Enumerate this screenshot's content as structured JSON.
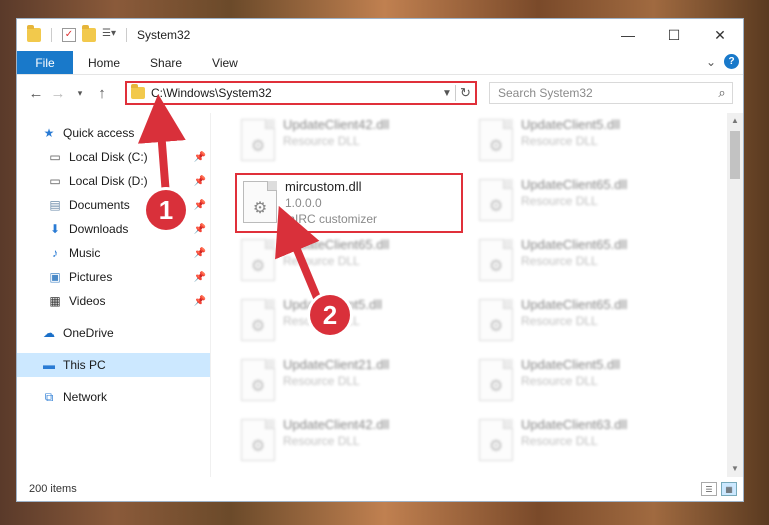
{
  "titlebar": {
    "title": "System32",
    "minimize": "—",
    "maximize": "☐",
    "close": "✕"
  },
  "ribbon": {
    "file": "File",
    "tabs": [
      "Home",
      "Share",
      "View"
    ],
    "expand": "⌄",
    "help": "?"
  },
  "address": {
    "path": "C:\\Windows\\System32",
    "search_placeholder": "Search System32"
  },
  "sidebar": {
    "quick_access": "Quick access",
    "items": [
      {
        "label": "Local Disk (C:)",
        "icon": "drive-icon"
      },
      {
        "label": "Local Disk (D:)",
        "icon": "drive-icon"
      },
      {
        "label": "Documents",
        "icon": "documents-icon"
      },
      {
        "label": "Downloads",
        "icon": "downloads-icon"
      },
      {
        "label": "Music",
        "icon": "music-icon"
      },
      {
        "label": "Pictures",
        "icon": "pictures-icon"
      },
      {
        "label": "Videos",
        "icon": "videos-icon"
      }
    ],
    "onedrive": "OneDrive",
    "this_pc": "This PC",
    "network": "Network"
  },
  "files": {
    "highlighted": {
      "name": "mircustom.dll",
      "version": "1.0.0.0",
      "description": "mIRC customizer"
    },
    "left_column": [
      {
        "name": "UpdateClient42.dll",
        "type": "Resource DLL"
      },
      {
        "name": "UpdateClient65.dll",
        "type": "Resource DLL"
      },
      {
        "name": "UpdateClient5.dll",
        "type": "Resource DLL"
      },
      {
        "name": "UpdateClient21.dll",
        "type": "Resource DLL"
      },
      {
        "name": "UpdateClient42.dll",
        "type": "Resource DLL"
      }
    ],
    "right_column": [
      {
        "name": "UpdateClient5.dll",
        "type": "Resource DLL"
      },
      {
        "name": "UpdateClient65.dll",
        "type": "Resource DLL"
      },
      {
        "name": "UpdateClient65.dll",
        "type": "Resource DLL"
      },
      {
        "name": "UpdateClient65.dll",
        "type": "Resource DLL"
      },
      {
        "name": "UpdateClient5.dll",
        "type": "Resource DLL"
      },
      {
        "name": "UpdateClient63.dll",
        "type": "Resource DLL"
      }
    ]
  },
  "status": {
    "count": "200 items"
  },
  "markers": [
    "1",
    "2"
  ],
  "colors": {
    "accent": "#1979ca",
    "highlight": "#e0303a",
    "selection": "#cce8ff"
  }
}
